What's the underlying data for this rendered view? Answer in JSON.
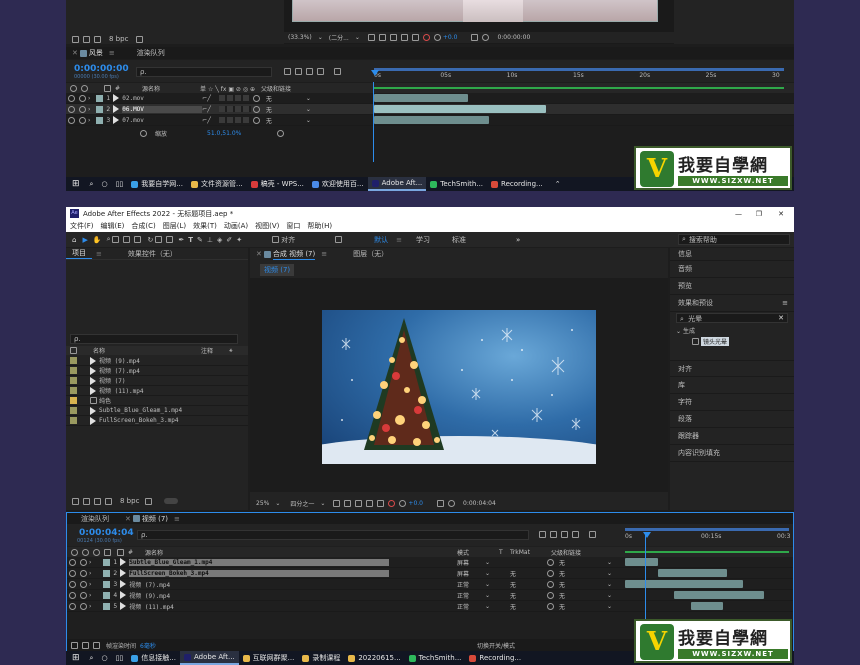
{
  "top": {
    "viewer_toolbar": {
      "zoom": "(33.3%)",
      "resolution": "(二分...",
      "exposure": "+0.0",
      "timecode": "0:00:00:00"
    },
    "project_footer": {
      "bpc": "8 bpc"
    },
    "tabs": [
      {
        "label": "风景"
      },
      {
        "label": "渲染队列"
      }
    ],
    "timecode": "0:00:00:00",
    "timecode_sub": "00000 (30.00 fps)",
    "search_placeholder": "ρ.",
    "col_name": "源名称",
    "col_parent": "父级和链接",
    "ruler": [
      "0s",
      "05s",
      "10s",
      "15s",
      "20s",
      "25s",
      "30"
    ],
    "layers": [
      {
        "num": "1",
        "name": "02.mov",
        "parent": "无",
        "bar_start": 0.0,
        "bar_end": 0.23
      },
      {
        "num": "2",
        "name": "06.MOV",
        "parent": "无",
        "bar_start": 0.0,
        "bar_end": 0.42
      },
      {
        "num": "3",
        "name": "07.mov",
        "parent": "无",
        "bar_start": 0.0,
        "bar_end": 0.28
      }
    ],
    "scale_label": "缩放",
    "scale_value": "51.0,51.0%",
    "taskbar": [
      {
        "label": "我要自学网...",
        "color": "#3aa0e8"
      },
      {
        "label": "文件资源管...",
        "color": "#e8b84a"
      },
      {
        "label": "稿壳 - WPS...",
        "color": "#d83b3b"
      },
      {
        "label": "欢迎使用百...",
        "color": "#4a8ae8"
      },
      {
        "label": "Adobe Aft...",
        "color": "#1f1f6a"
      },
      {
        "label": "TechSmith...",
        "color": "#2eb85c"
      },
      {
        "label": "Recording...",
        "color": "#d84a3a"
      }
    ]
  },
  "bottom": {
    "title": "Adobe After Effects 2022 - 无标题项目.aep *",
    "menu": [
      "文件(F)",
      "编辑(E)",
      "合成(C)",
      "图层(L)",
      "效果(T)",
      "动画(A)",
      "视图(V)",
      "窗口",
      "帮助(H)"
    ],
    "align_label": "对齐",
    "workspaces": [
      "默认",
      "学习",
      "标准"
    ],
    "search_help": "搜索帮助",
    "project_tabs": [
      {
        "label": "项目"
      },
      {
        "label": "效果控件（无）"
      }
    ],
    "comp_tabs": [
      {
        "label": "合成 视频 (7)"
      },
      {
        "label": "图层（无）"
      }
    ],
    "comp_subtab": "视频 (7)",
    "project_search": "ρ.",
    "project_cols": {
      "name": "名称",
      "note": "注释"
    },
    "project_items": [
      {
        "name": "视频 (9).mp4",
        "color": "#9a9a60"
      },
      {
        "name": "视频 (7).mp4",
        "color": "#9a9a60"
      },
      {
        "name": "视频 (7)",
        "color": "#9a9a60"
      },
      {
        "name": "视频 (11).mp4",
        "color": "#9a9a60"
      },
      {
        "name": "纯色",
        "color": "#d8b450"
      },
      {
        "name": "Subtle_Blue_Gleam_1.mp4",
        "color": "#9a9a60"
      },
      {
        "name": "FullScreen_Bokeh_3.mp4",
        "color": "#9a9a60"
      }
    ],
    "project_footer": {
      "bpc": "8 bpc"
    },
    "viewer_toolbar": {
      "zoom": "25%",
      "resolution": "四分之一",
      "exposure": "+0.0",
      "timecode": "0:00:04:04"
    },
    "right_panels": [
      "信息",
      "音频",
      "预览",
      "效果和预设",
      "对齐",
      "库",
      "字符",
      "段落",
      "跟踪器",
      "内容识别填充"
    ],
    "effects_search": "光晕",
    "effects_group": "生成",
    "effects_item": "镜头光晕",
    "tl_tabs": [
      {
        "label": "渲染队列"
      },
      {
        "label": "视频 (7)"
      }
    ],
    "timecode": "0:00:04:04",
    "timecode_sub": "00124 (30.00 fps)",
    "search_placeholder": "ρ.",
    "col_name": "源名称",
    "col_mode": "模式",
    "col_t": "T",
    "col_trkmat": "TrkMat",
    "col_parent": "父级和链接",
    "ruler": [
      "0s",
      "00:15s",
      "00:3"
    ],
    "layers": [
      {
        "num": "1",
        "name": "Subtle_Blue_Gleam_1.mp4",
        "mode": "屏幕",
        "trkmat": "",
        "parent": "无",
        "bar_start": 0.0,
        "bar_end": 0.2
      },
      {
        "num": "2",
        "name": "FullScreen_Bokeh_3.mp4",
        "mode": "屏幕",
        "trkmat": "无",
        "parent": "无",
        "bar_start": 0.2,
        "bar_end": 0.62
      },
      {
        "num": "3",
        "name": "视频 (7).mp4",
        "mode": "正常",
        "trkmat": "无",
        "parent": "无",
        "bar_start": 0.0,
        "bar_end": 0.72
      },
      {
        "num": "4",
        "name": "视频 (9).mp4",
        "mode": "正常",
        "trkmat": "无",
        "parent": "无",
        "bar_start": 0.3,
        "bar_end": 0.85
      },
      {
        "num": "5",
        "name": "视频 (11).mp4",
        "mode": "正常",
        "trkmat": "无",
        "parent": "无",
        "bar_start": 0.4,
        "bar_end": 0.6
      }
    ],
    "footer_render_label": "帧渲染时间",
    "footer_render_value": "6毫秒",
    "footer_switch": "切换开关/模式",
    "taskbar": [
      {
        "label": "信息接触...",
        "color": "#3aa0e8"
      },
      {
        "label": "Adobe Aft...",
        "color": "#1f1f6a"
      },
      {
        "label": "互联网群聚...",
        "color": "#e8b84a"
      },
      {
        "label": "录制课程",
        "color": "#e8b84a"
      },
      {
        "label": "20220615...",
        "color": "#e8b84a"
      },
      {
        "label": "TechSmith...",
        "color": "#2eb85c"
      },
      {
        "label": "Recording...",
        "color": "#d84a3a"
      }
    ]
  },
  "watermark": {
    "logo": "V",
    "text": "我要自學網",
    "url": "WWW.SIZXW.NET"
  },
  "colors": {
    "accent": "#2d8ceb",
    "layer_bar": "#8fb0b0",
    "timeline_green": "#2fa84a"
  }
}
